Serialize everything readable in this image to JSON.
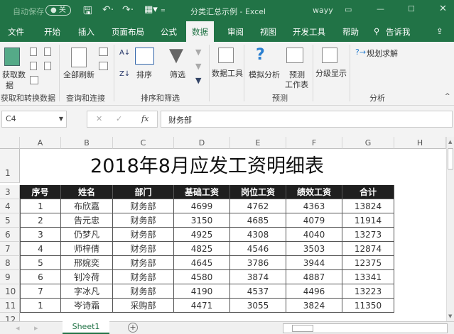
{
  "titlebar": {
    "autosave": "自动保存",
    "toggle": "关",
    "doc_title": "分类汇总示例 - Excel",
    "user": "wayy"
  },
  "tabs": [
    "文件",
    "开始",
    "插入",
    "页面布局",
    "公式",
    "数据",
    "审阅",
    "视图",
    "开发工具",
    "帮助",
    "告诉我"
  ],
  "ribbon": {
    "get_data": "获取数",
    "get_data2": "据",
    "refresh_all": "全部刷新",
    "sort": "排序",
    "filter": "筛选",
    "data_tools": "数据工具",
    "what_if": "模拟分析",
    "forecast": "预测",
    "forecast2": "工作表",
    "outline": "分级显示",
    "solver": "规划求解",
    "groups": [
      "获取和转换数据",
      "查询和连接",
      "排序和筛选",
      "预测",
      "分析"
    ]
  },
  "formula_bar": {
    "name_box": "C4",
    "fx": "fx",
    "value": "财务部"
  },
  "columns": [
    "A",
    "B",
    "C",
    "D",
    "E",
    "F",
    "G",
    "H"
  ],
  "sheet_title": "2018年8月应发工资明细表",
  "table": {
    "headers": [
      "序号",
      "姓名",
      "部门",
      "基础工资",
      "岗位工资",
      "绩效工资",
      "合计"
    ],
    "rows": [
      [
        "1",
        "布欣嘉",
        "财务部",
        "4699",
        "4762",
        "4363",
        "13824"
      ],
      [
        "2",
        "告元忠",
        "财务部",
        "3150",
        "4685",
        "4079",
        "11914"
      ],
      [
        "3",
        "仍梦凡",
        "财务部",
        "4925",
        "4308",
        "4040",
        "13273"
      ],
      [
        "4",
        "师梓倩",
        "财务部",
        "4825",
        "4546",
        "3503",
        "12874"
      ],
      [
        "5",
        "邢婉奕",
        "财务部",
        "4645",
        "3786",
        "3944",
        "12375"
      ],
      [
        "6",
        "钊冷荷",
        "财务部",
        "4580",
        "3874",
        "4887",
        "13341"
      ],
      [
        "7",
        "字冰凡",
        "财务部",
        "4190",
        "4537",
        "4496",
        "13223"
      ],
      [
        "1",
        "岑诗霜",
        "采购部",
        "4471",
        "3055",
        "3824",
        "11350"
      ]
    ]
  },
  "row_numbers": [
    "1",
    "3",
    "4",
    "5",
    "6",
    "7",
    "8",
    "9",
    "10",
    "11",
    "12"
  ],
  "sheet_tab": "Sheet1"
}
